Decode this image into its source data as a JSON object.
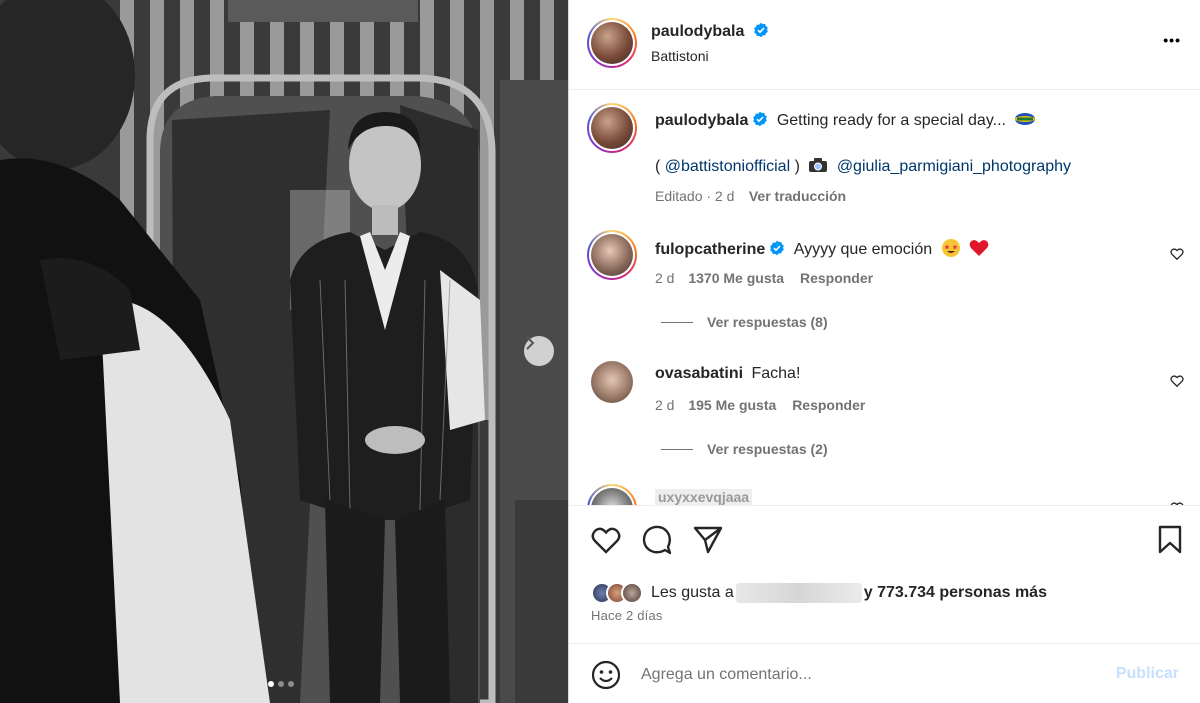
{
  "post": {
    "author": "paulodybala",
    "location": "Battistoni",
    "more_label": "•••"
  },
  "caption": {
    "author": "paulodybala",
    "text": "Getting ready for a special day...",
    "line2_open": "(",
    "mention1": "@battistoniofficial",
    "line2_close": ")",
    "mention2": "@giulia_parmigiani_photography",
    "edited": "Editado · 2 d",
    "translate": "Ver traducción"
  },
  "comments": [
    {
      "author": "fulopcatherine",
      "text": "Ayyyy que emoción",
      "time": "2 d",
      "likes": "1370 Me gusta",
      "reply": "Responder",
      "view_replies": "Ver respuestas (8)"
    },
    {
      "author": "ovasabatini",
      "text": "Facha!",
      "time": "2 d",
      "likes": "195 Me gusta",
      "reply": "Responder",
      "view_replies": "Ver respuestas (2)"
    },
    {
      "author": "uxyxxevqjaaa"
    }
  ],
  "likes": {
    "prefix": "Les gusta a",
    "suffix": "y 773.734 personas más",
    "time": "Hace 2 días"
  },
  "comment_box": {
    "placeholder": "Agrega un comentario...",
    "publish": "Publicar"
  },
  "colors": {
    "verified": "#0095f6",
    "link": "#00376b",
    "muted": "#737373",
    "publish_disabled": "#c7e0fd"
  },
  "carousel": {
    "slides": 3,
    "current": 1
  }
}
